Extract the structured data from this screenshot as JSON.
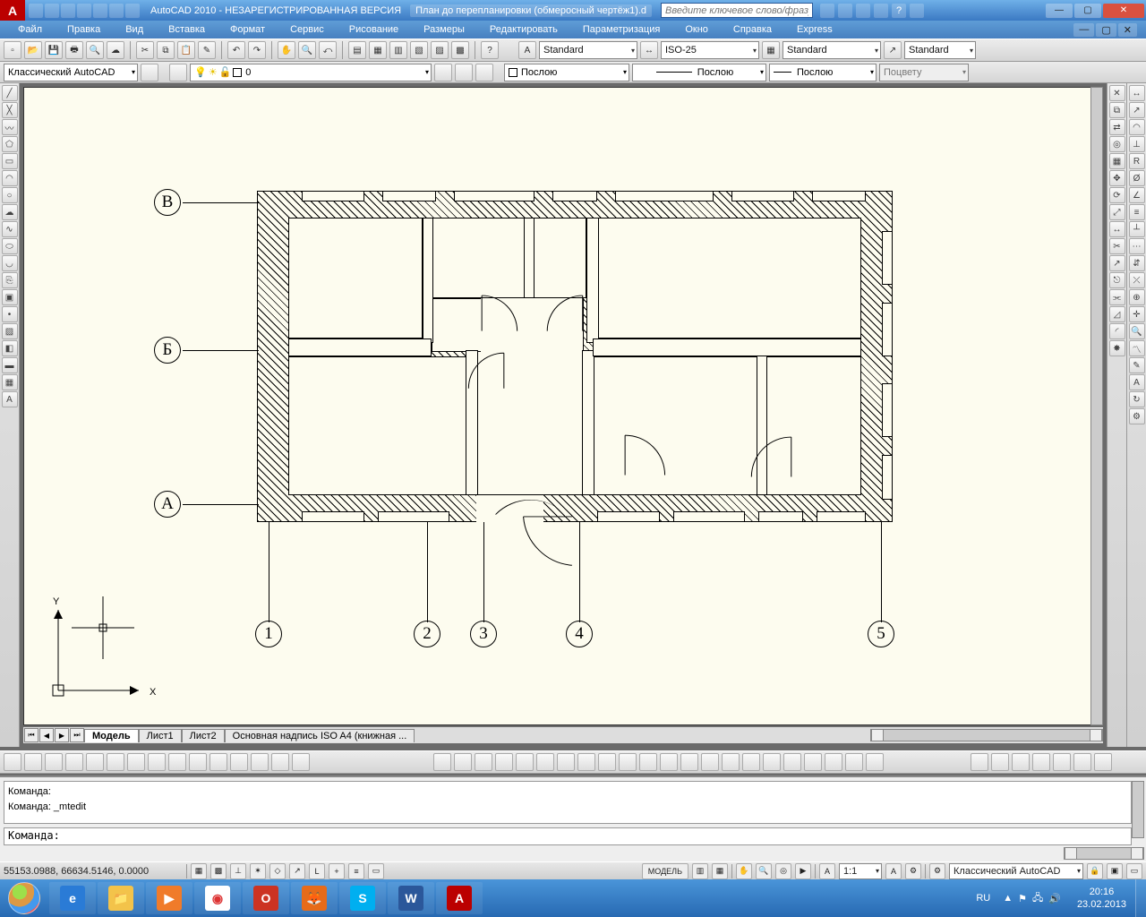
{
  "titlebar": {
    "app_title": "AutoCAD 2010 - НЕЗАРЕГИСТРИРОВАННАЯ ВЕРСИЯ",
    "doc_name": "План до перепланировки (обмеросный чертёж1).d",
    "search_placeholder": "Введите ключевое слово/фразу"
  },
  "menu": [
    "Файл",
    "Правка",
    "Вид",
    "Вставка",
    "Формат",
    "Сервис",
    "Рисование",
    "Размеры",
    "Редактировать",
    "Параметризация",
    "Окно",
    "Справка",
    "Express"
  ],
  "styles_toolbar": {
    "text_style": "Standard",
    "dim_style": "ISO-25",
    "table_style": "Standard",
    "mleader_style": "Standard"
  },
  "workspace_selector": "Классический AutoCAD",
  "layer_selector": "0",
  "properties_bar": {
    "color": "Послою",
    "linetype": "Послою",
    "lineweight": "Послою",
    "plotstyle": "Поцвету"
  },
  "layout_tabs": {
    "nav": [
      "⏮",
      "◀",
      "▶",
      "⏭"
    ],
    "tabs": [
      "Модель",
      "Лист1",
      "Лист2",
      "Основная надпись ISO A4 (книжная ..."
    ],
    "active": 0
  },
  "command": {
    "history_line1": "Команда:",
    "history_line2": "Команда: _mtedit",
    "prompt": "Команда:"
  },
  "statusbar": {
    "coords": "55153.0988, 66634.5146, 0.0000",
    "model_btn": "МОДЕЛЬ",
    "scale": "1:1",
    "workspace": "Классический AutoCAD"
  },
  "plan_axes": {
    "horizontal": [
      "В",
      "Б",
      "А"
    ],
    "vertical": [
      "1",
      "2",
      "3",
      "4",
      "5"
    ]
  },
  "ucs_labels": {
    "x": "X",
    "y": "Y"
  },
  "taskbar": {
    "lang": "RU",
    "time": "20:16",
    "date": "23.02.2013"
  }
}
